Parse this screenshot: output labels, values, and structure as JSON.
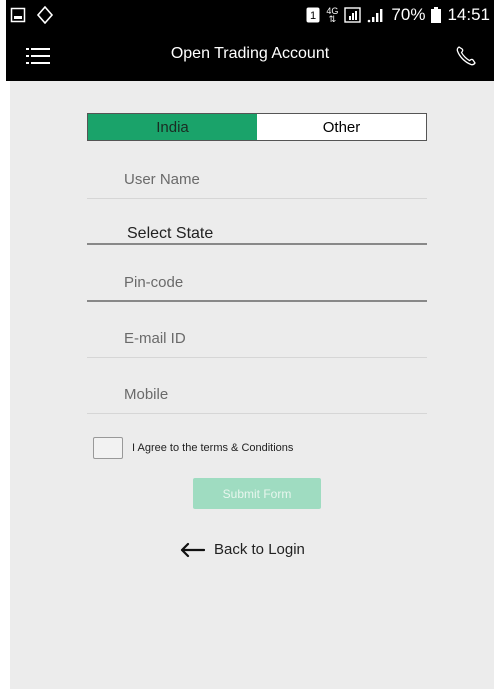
{
  "status_bar": {
    "battery_percent": "70%",
    "time": "14:51",
    "network": "4G",
    "sim_badge": "1",
    "icons": [
      "image-icon",
      "sync-diamond-icon",
      "sim-badge-icon",
      "network-4g-icon",
      "signal-box-icon",
      "signal-bars-icon",
      "battery-icon"
    ]
  },
  "app_bar": {
    "title": "Open Trading Account",
    "menu_icon": "hamburger-menu-icon",
    "call_icon": "phone-icon"
  },
  "form": {
    "region_options": [
      {
        "label": "India",
        "selected": true
      },
      {
        "label": "Other",
        "selected": false
      }
    ],
    "fields": {
      "username_placeholder": "User Name",
      "state_label": "Select State",
      "pincode_placeholder": "Pin-code",
      "email_placeholder": "E-mail ID",
      "mobile_placeholder": "Mobile"
    },
    "agree_label": "I Agree to the terms & Conditions",
    "agree_checked": false,
    "submit_label": "Submit Form",
    "back_label": "Back to Login"
  },
  "colors": {
    "accent": "#1aa36a",
    "submit_disabled": "#9fdcc1",
    "background": "#ececec",
    "app_bar": "#000000"
  }
}
